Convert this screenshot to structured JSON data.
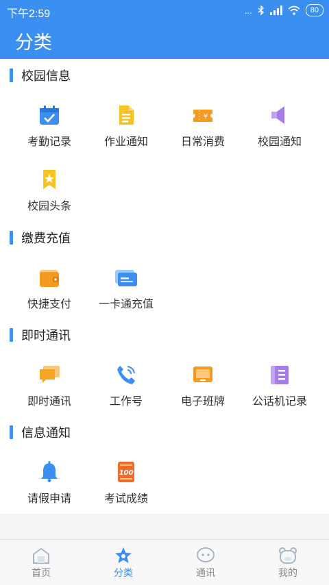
{
  "status": {
    "time": "下午2:59",
    "dots": "...",
    "battery": "80"
  },
  "header": {
    "title": "分类"
  },
  "sections": [
    {
      "title": "校园信息",
      "items": [
        {
          "label": "考勤记录",
          "icon": "calendar-check-icon"
        },
        {
          "label": "作业通知",
          "icon": "document-icon"
        },
        {
          "label": "日常消费",
          "icon": "ticket-yen-icon"
        },
        {
          "label": "校园通知",
          "icon": "speaker-icon"
        },
        {
          "label": "校园头条",
          "icon": "bookmark-star-icon"
        }
      ]
    },
    {
      "title": "缴费充值",
      "items": [
        {
          "label": "快捷支付",
          "icon": "wallet-icon"
        },
        {
          "label": "一卡通充值",
          "icon": "card-icon"
        }
      ]
    },
    {
      "title": "即时通讯",
      "items": [
        {
          "label": "即时通讯",
          "icon": "chat-bubble-icon"
        },
        {
          "label": "工作号",
          "icon": "phone-icon"
        },
        {
          "label": "电子班牌",
          "icon": "tablet-icon"
        },
        {
          "label": "公话机记录",
          "icon": "notebook-icon"
        }
      ]
    },
    {
      "title": "信息通知",
      "items": [
        {
          "label": "请假申请",
          "icon": "bell-icon"
        },
        {
          "label": "考试成绩",
          "icon": "score-100-icon"
        }
      ]
    }
  ],
  "tabs": [
    {
      "label": "首页",
      "icon": "home-icon",
      "active": false
    },
    {
      "label": "分类",
      "icon": "star-icon",
      "active": true
    },
    {
      "label": "通讯",
      "icon": "chat-icon",
      "active": false
    },
    {
      "label": "我的",
      "icon": "bear-icon",
      "active": false
    }
  ],
  "colors": {
    "primary": "#3b8ff0",
    "orange": "#f39a1f",
    "yellow": "#f6c323",
    "purple": "#a77be8",
    "blue": "#3b8ff0"
  }
}
